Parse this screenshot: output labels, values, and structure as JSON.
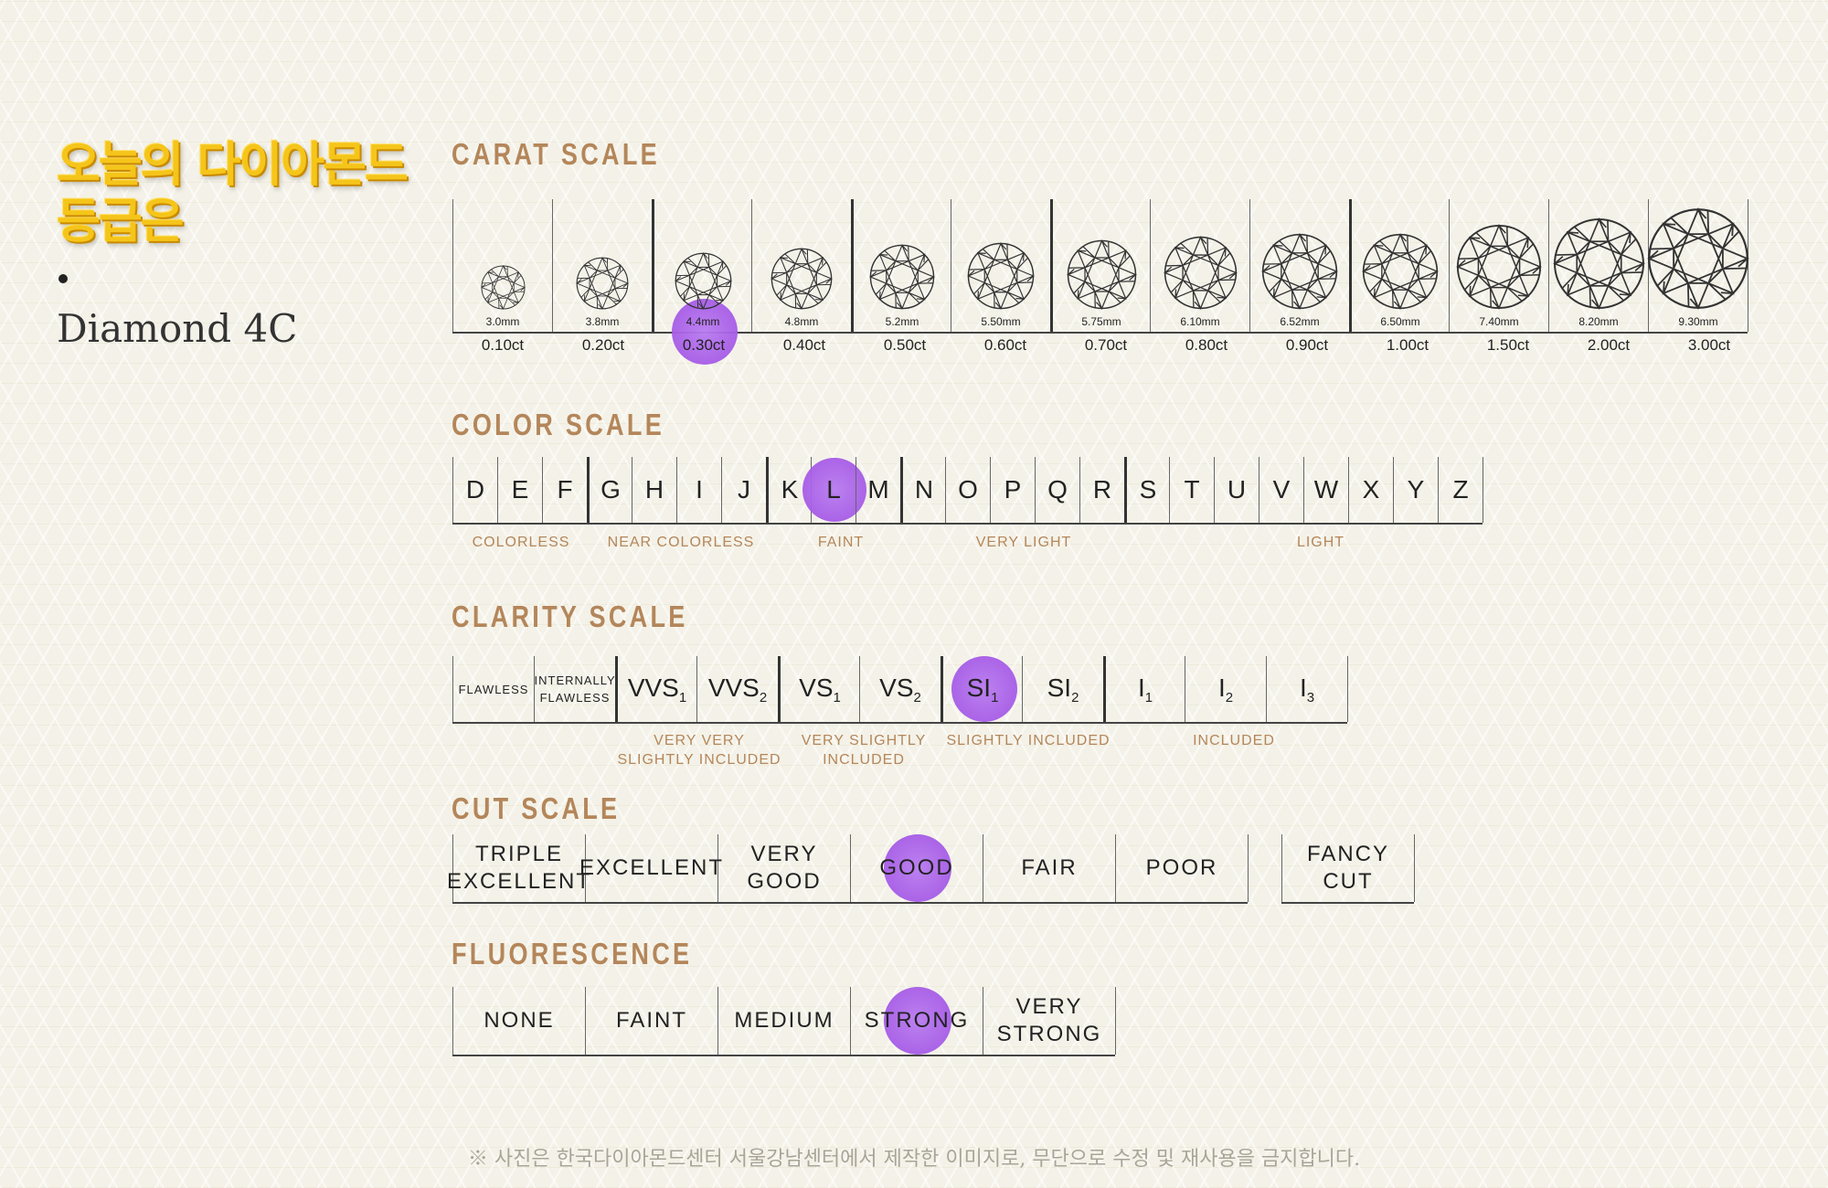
{
  "title_lines": [
    "오늘의 다이아몬드",
    "등급은"
  ],
  "subtitle": "Diamond 4C",
  "highlight_color": "#a55ae6",
  "accent_color": "#b4865a",
  "carat": {
    "title": "CARAT SCALE",
    "items": [
      {
        "mm": "3.0mm",
        "ct": "0.10ct",
        "d": 0.32
      },
      {
        "mm": "3.8mm",
        "ct": "0.20ct",
        "d": 0.41
      },
      {
        "mm": "4.4mm",
        "ct": "0.30ct",
        "d": 0.47
      },
      {
        "mm": "4.8mm",
        "ct": "0.40ct",
        "d": 0.52
      },
      {
        "mm": "5.2mm",
        "ct": "0.50ct",
        "d": 0.56
      },
      {
        "mm": "5.50mm",
        "ct": "0.60ct",
        "d": 0.59
      },
      {
        "mm": "5.75mm",
        "ct": "0.70ct",
        "d": 0.62
      },
      {
        "mm": "6.10mm",
        "ct": "0.80ct",
        "d": 0.66
      },
      {
        "mm": "6.52mm",
        "ct": "0.90ct",
        "d": 0.7
      },
      {
        "mm": "6.50mm",
        "ct": "1.00ct",
        "d": 0.7
      },
      {
        "mm": "7.40mm",
        "ct": "1.50ct",
        "d": 0.8
      },
      {
        "mm": "8.20mm",
        "ct": "2.00ct",
        "d": 0.88
      },
      {
        "mm": "9.30mm",
        "ct": "3.00ct",
        "d": 1.0
      }
    ],
    "selected": 2
  },
  "color": {
    "title": "COLOR SCALE",
    "grades": [
      "D",
      "E",
      "F",
      "G",
      "H",
      "I",
      "J",
      "K",
      "L",
      "M",
      "N",
      "O",
      "P",
      "Q",
      "R",
      "S",
      "T",
      "U",
      "V",
      "W",
      "X",
      "Y",
      "Z"
    ],
    "group_starts": [
      0,
      3,
      7,
      10,
      15
    ],
    "groups": [
      "COLORLESS",
      "NEAR COLORLESS",
      "FAINT",
      "VERY LIGHT",
      "LIGHT"
    ],
    "selected": 8
  },
  "clarity": {
    "title": "CLARITY SCALE",
    "grades": [
      {
        "main": "FLAWLESS",
        "sub": "",
        "small": true
      },
      {
        "main": "INTERNALLY FLAWLESS",
        "sub": "",
        "small": true
      },
      {
        "main": "VVS",
        "sub": "1"
      },
      {
        "main": "VVS",
        "sub": "2"
      },
      {
        "main": "VS",
        "sub": "1"
      },
      {
        "main": "VS",
        "sub": "2"
      },
      {
        "main": "SI",
        "sub": "1"
      },
      {
        "main": "SI",
        "sub": "2"
      },
      {
        "main": "I",
        "sub": "1"
      },
      {
        "main": "I",
        "sub": "2"
      },
      {
        "main": "I",
        "sub": "3"
      }
    ],
    "group_starts": [
      2,
      4,
      6,
      8
    ],
    "groups": [
      "VERY VERY SLIGHTLY INCLUDED",
      "VERY SLIGHTLY INCLUDED",
      "SLIGHTLY INCLUDED",
      "INCLUDED"
    ],
    "selected": 6
  },
  "cut": {
    "title": "CUT SCALE",
    "grades": [
      "TRIPLE EXCELLENT",
      "EXCELLENT",
      "VERY GOOD",
      "GOOD",
      "FAIR",
      "POOR"
    ],
    "extra": "FANCY CUT",
    "selected": 3
  },
  "fluorescence": {
    "title": "FLUORESCENCE",
    "grades": [
      "NONE",
      "FAINT",
      "MEDIUM",
      "STRONG",
      "VERY STRONG"
    ],
    "selected": 3
  },
  "footnote": "※ 사진은 한국다이아몬드센터 서울강남센터에서 제작한 이미지로, 무단으로 수정 및 재사용을 금지합니다."
}
